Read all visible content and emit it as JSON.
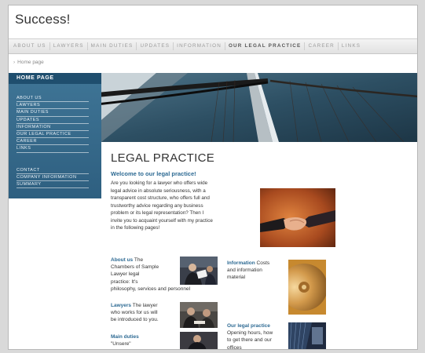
{
  "site": {
    "title": "Success!"
  },
  "topnav": {
    "items": [
      {
        "label": "ABOUT US"
      },
      {
        "label": "LAWYERS"
      },
      {
        "label": "MAIN DUTIES"
      },
      {
        "label": "UPDATES"
      },
      {
        "label": "INFORMATION"
      },
      {
        "label": "OUR LEGAL PRACTICE",
        "active": true
      },
      {
        "label": "CAREER"
      },
      {
        "label": "LINKS"
      }
    ]
  },
  "breadcrumb": {
    "label": "Home page"
  },
  "sidebar": {
    "heading": "HOME PAGE",
    "items": [
      "ABOUT US",
      "LAWYERS",
      "MAIN DUTIES",
      "UPDATES",
      "INFORMATION",
      "OUR LEGAL PRACTICE",
      "CAREER",
      "LINKS"
    ],
    "lower_items": [
      "CONTACT",
      "COMPANY INFORMATION",
      "SUMMARY"
    ]
  },
  "main": {
    "title": "LEGAL PRACTICE",
    "welcome": "Welcome to our legal practice!",
    "intro_lines": [
      "Are you looking for a lawyer who offers wide",
      "legal advice in absolute seriousness, with a",
      "transparent cost structure, who offers full and",
      "trustworthy advice regarding any business",
      "problem or its legal representation? Then I",
      "invite you to acquaint yourself with my practice",
      "in the following pages!"
    ]
  },
  "teasers": {
    "about": {
      "link": "About us",
      "lines": [
        " The",
        "Chambers of Sample",
        "Lawyer legal",
        "practice: It's",
        "philosophy, services and personnel"
      ]
    },
    "lawyers": {
      "link": "Lawyers",
      "lines": [
        " The lawyer",
        "who works for us will",
        "be introduced to you."
      ]
    },
    "duties": {
      "link": "Main duties",
      "lines": [
        "\"Unsere\""
      ]
    },
    "information": {
      "link": "Information",
      "lines": [
        " Costs",
        "and information",
        "material"
      ]
    },
    "practice": {
      "link": "Our legal practice",
      "lines": [
        "Opening hours, how",
        "to get there and our",
        "offices"
      ]
    }
  },
  "colors": {
    "accent": "#2d6a93",
    "sidebar": "#3a6d8f"
  }
}
